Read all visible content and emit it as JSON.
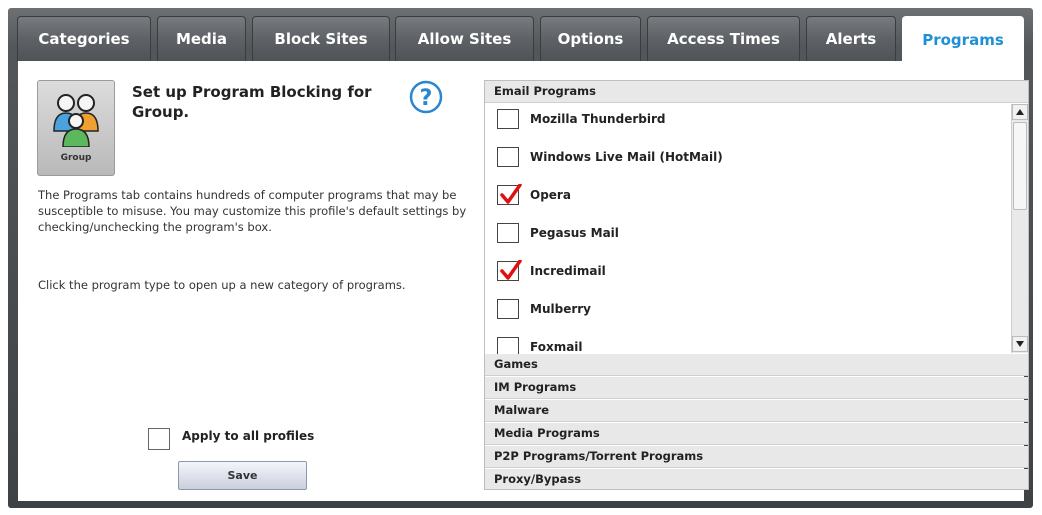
{
  "tabs": [
    {
      "label": "Categories",
      "active": false
    },
    {
      "label": "Media",
      "active": false
    },
    {
      "label": "Block Sites",
      "active": false
    },
    {
      "label": "Allow Sites",
      "active": false
    },
    {
      "label": "Options",
      "active": false
    },
    {
      "label": "Access Times",
      "active": false
    },
    {
      "label": "Alerts",
      "active": false
    },
    {
      "label": "Programs",
      "active": true
    }
  ],
  "left": {
    "group_label": "Group",
    "title": "Set up Program Blocking for Group.",
    "description_1": "The Programs tab contains hundreds of computer programs that may be susceptible to misuse.  You may customize this profile's default settings by checking/unchecking the program's box.",
    "description_2": "Click the program type to open up a new category of programs.",
    "apply_label": "Apply to all profiles",
    "apply_checked": false,
    "save_label": "Save"
  },
  "categories": {
    "expanded": "Email Programs",
    "email_programs": [
      {
        "name": "Mozilla Thunderbird",
        "checked": false
      },
      {
        "name": "Windows Live Mail (HotMail)",
        "checked": false
      },
      {
        "name": "Opera",
        "checked": true
      },
      {
        "name": "Pegasus Mail",
        "checked": false
      },
      {
        "name": "Incredimail",
        "checked": false,
        "checked_visible": true
      },
      {
        "name": "Mulberry",
        "checked": false
      },
      {
        "name": "Foxmail",
        "checked": false
      }
    ],
    "collapsed": [
      "Games",
      "IM Programs",
      "Malware",
      "Media Programs",
      "P2P Programs/Torrent Programs",
      "Proxy/Bypass"
    ]
  },
  "colors": {
    "active_tab_text": "#1f8fd6",
    "check_mark": "#e01010"
  },
  "icons": {
    "help": "help-icon",
    "group": "group-people-icon",
    "scroll_up": "scroll-up-arrow-icon",
    "scroll_down": "scroll-down-arrow-icon"
  }
}
